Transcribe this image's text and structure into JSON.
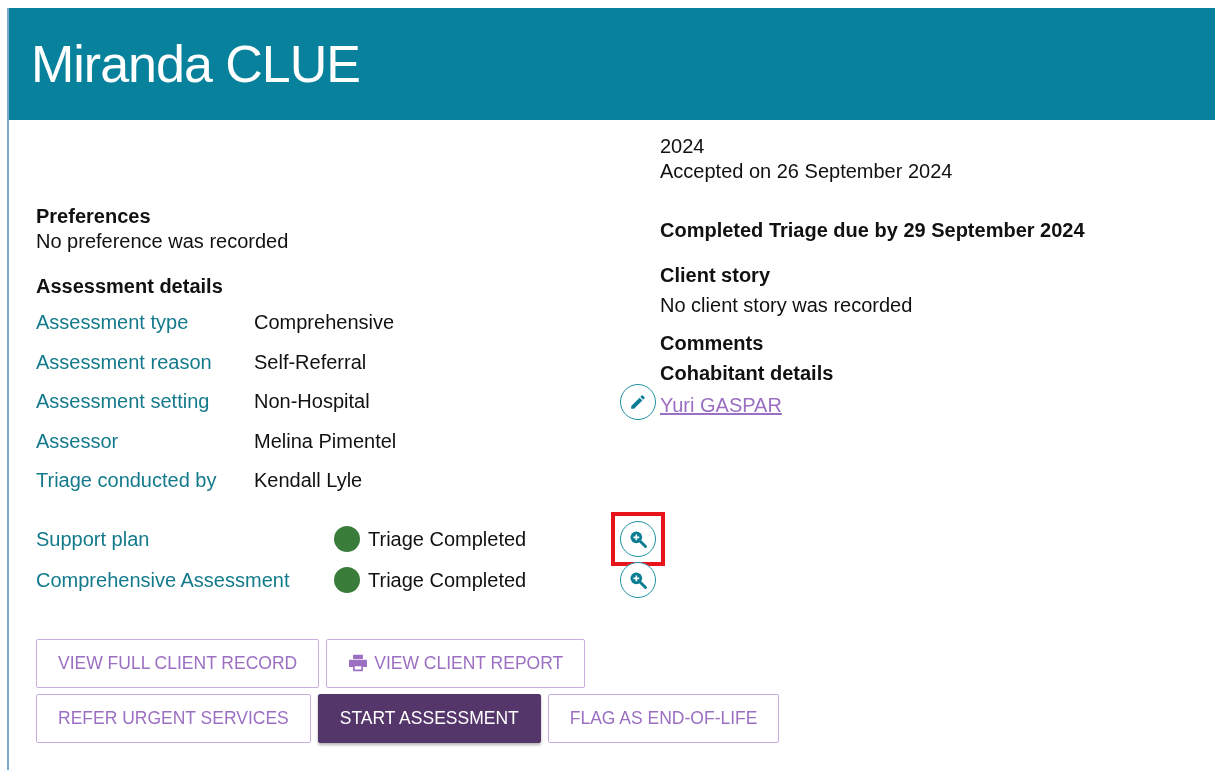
{
  "header": {
    "title": "Miranda CLUE"
  },
  "referral": [
    "2024",
    "Accepted on 26 September 2024"
  ],
  "preferences": {
    "heading": "Preferences",
    "text": "No preference was recorded"
  },
  "assessment_details": {
    "heading": "Assessment details",
    "rows": [
      {
        "label": "Assessment type",
        "value": "Comprehensive",
        "editable": false
      },
      {
        "label": "Assessment reason",
        "value": "Self-Referral",
        "editable": false
      },
      {
        "label": "Assessment setting",
        "value": "Non-Hospital",
        "editable": true
      },
      {
        "label": "Assessor",
        "value": "Melina Pimentel",
        "editable": false
      },
      {
        "label": "Triage conducted by",
        "value": "Kendall Lyle",
        "editable": false
      }
    ]
  },
  "plans": [
    {
      "label": "Support plan",
      "status": "Triage Completed",
      "color": "#3a7d3a",
      "highlighted": true
    },
    {
      "label": "Comprehensive Assessment",
      "status": "Triage Completed",
      "color": "#3a7d3a",
      "highlighted": false
    }
  ],
  "triage_due": "Completed Triage due by 29 September 2024",
  "client_story": {
    "heading": "Client story",
    "text": "No client story was recorded"
  },
  "comments": {
    "heading": "Comments"
  },
  "cohabitant": {
    "heading": "Cohabitant details",
    "link": "Yuri GASPAR"
  },
  "button_rows": [
    [
      {
        "label": "VIEW FULL CLIENT RECORD",
        "kind": "outline"
      },
      {
        "label": "VIEW CLIENT REPORT",
        "kind": "print"
      }
    ],
    [
      {
        "label": "REFER URGENT SERVICES",
        "kind": "outline"
      },
      {
        "label": "START ASSESSMENT",
        "kind": "primary"
      },
      {
        "label": "FLAG AS END-OF-LIFE",
        "kind": "outline"
      }
    ]
  ]
}
